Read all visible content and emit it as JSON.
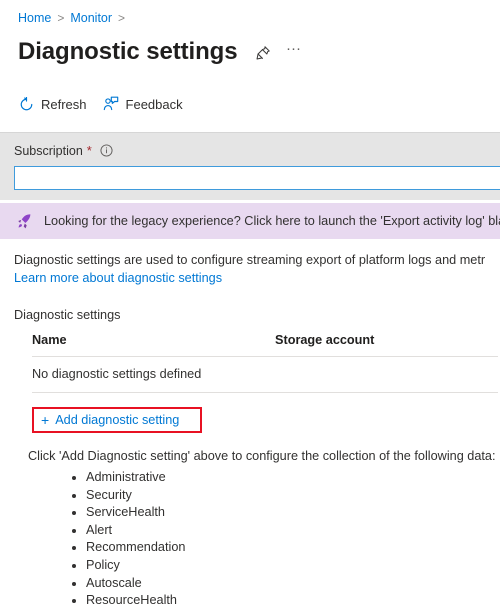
{
  "breadcrumb": {
    "items": [
      "Home",
      "Monitor"
    ],
    "separator": ">"
  },
  "header": {
    "title": "Diagnostic settings",
    "pin_icon": "pushpin-icon",
    "more_icon": "ellipsis-icon",
    "more_label": "···"
  },
  "commandbar": {
    "items": [
      {
        "label": "Refresh",
        "icon": "refresh-icon"
      },
      {
        "label": "Feedback",
        "icon": "feedback-icon"
      }
    ]
  },
  "filter": {
    "label": "Subscription",
    "required_marker": "*",
    "info_icon": "info-icon",
    "value": "",
    "placeholder": ""
  },
  "banner": {
    "icon": "rocket-icon",
    "text": "Looking for the legacy experience? Click here to launch the 'Export activity log' blade"
  },
  "description": {
    "text": "Diagnostic settings are used to configure streaming export of platform logs and metr",
    "link": "Learn more about diagnostic settings"
  },
  "section": {
    "label": "Diagnostic settings"
  },
  "table": {
    "columns": [
      "Name",
      "Storage account"
    ],
    "empty_message": "No diagnostic settings defined"
  },
  "add_setting": {
    "plus": "+",
    "label": "Add diagnostic setting",
    "highlight_color": "#e81123"
  },
  "footer": {
    "note": "Click 'Add Diagnostic setting' above to configure the collection of the following data:",
    "data_types": [
      "Administrative",
      "Security",
      "ServiceHealth",
      "Alert",
      "Recommendation",
      "Policy",
      "Autoscale",
      "ResourceHealth"
    ]
  },
  "colors": {
    "link": "#0078d4",
    "banner_bg": "#e8d9f0",
    "banner_icon": "#7b3fa0",
    "filter_bg": "#e5e5e5",
    "input_border": "#3f9bdc",
    "required": "#a4262c"
  }
}
